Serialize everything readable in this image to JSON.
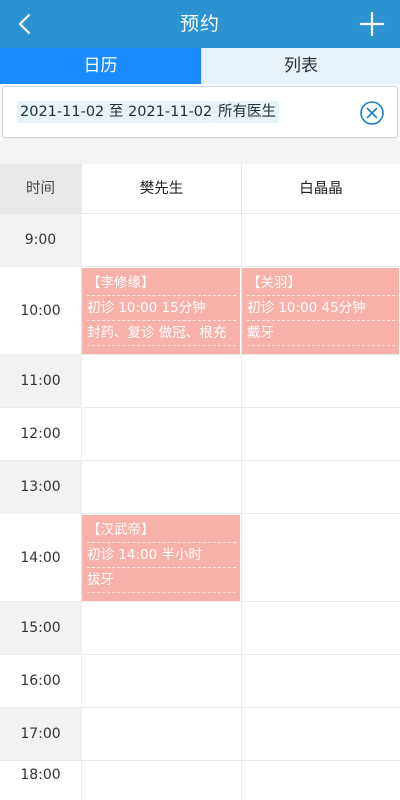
{
  "header": {
    "title": "预约"
  },
  "tabs": [
    {
      "label": "日历",
      "active": true
    },
    {
      "label": "列表",
      "active": false
    }
  ],
  "filter": {
    "date_range": "2021-11-02 至 2021-11-02",
    "doctor": "所有医生"
  },
  "schedule": {
    "time_header": "时间",
    "doctors": [
      "樊先生",
      "白晶晶"
    ],
    "hours": [
      "9:00",
      "10:00",
      "11:00",
      "12:00",
      "13:00",
      "14:00",
      "15:00",
      "16:00",
      "17:00",
      "18:00"
    ]
  },
  "appointments": [
    {
      "patient": "【李修缘】",
      "detail": "初诊 10:00 15分钟",
      "items": "封药、复诊 做冠、根充"
    },
    {
      "patient": "【关羽】",
      "detail": "初诊 10:00 45分钟",
      "items": "戴牙"
    },
    {
      "patient": "【汉武帝】",
      "detail": "初诊 14:00 半小时",
      "items": "拔牙"
    }
  ],
  "colors": {
    "header_bg": "#2b93cf",
    "tab_active": "#1a8cff",
    "appointment_bg": "#f8b1a8"
  },
  "icons": {
    "back": "chevron-left-icon",
    "add": "plus-icon",
    "clear": "close-circle-icon"
  }
}
